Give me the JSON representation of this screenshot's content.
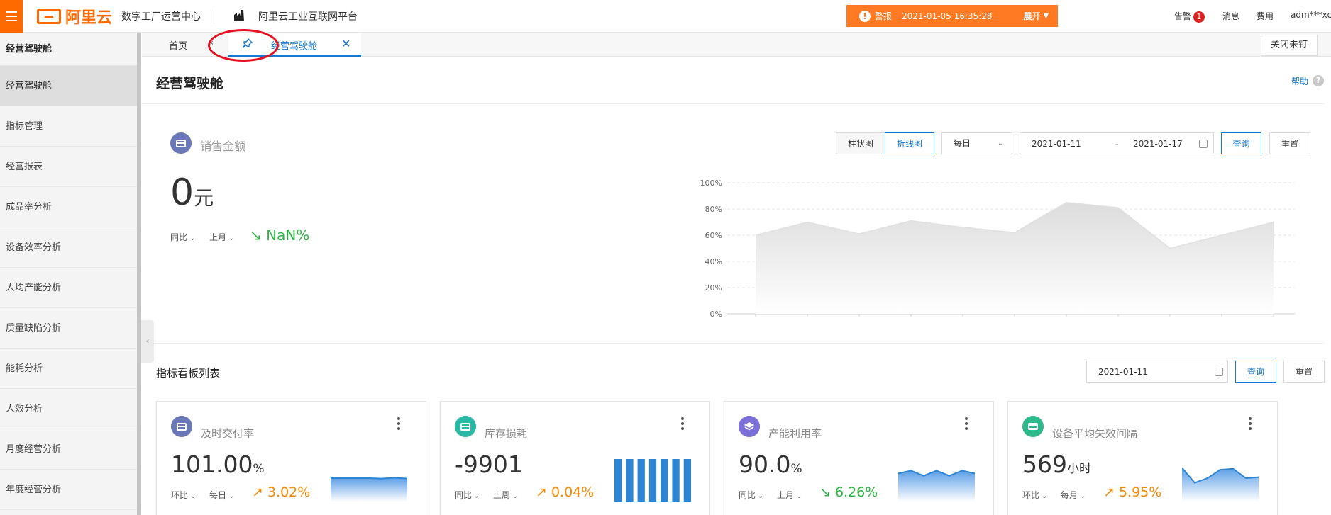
{
  "header": {
    "logo_text": "阿里云",
    "center_name": "数字工厂运营中心",
    "platform_name": "阿里云工业互联网平台",
    "alert": {
      "label": "警报",
      "time": "2021-01-05 16:35:28",
      "expand": "展开"
    },
    "nav": {
      "alarm": "告警",
      "alarm_count": "1",
      "messages": "消息",
      "billing": "费用",
      "user": "adm***xc"
    }
  },
  "sidebar": {
    "header": "经营驾驶舱",
    "items": [
      "经营驾驶舱",
      "指标管理",
      "经营报表",
      "成品率分析",
      "设备效率分析",
      "人均产能分析",
      "质量缺陷分析",
      "能耗分析",
      "人效分析",
      "月度经营分析",
      "年度经营分析"
    ]
  },
  "tabs": {
    "home": "首页",
    "active": "经营驾驶舱",
    "close_pinned": "关闭未钉"
  },
  "page": {
    "title": "经营驾驶舱",
    "help": "帮助"
  },
  "sales": {
    "title": "销售金额",
    "value": "0",
    "unit": "元",
    "compare": "同比",
    "period": "上月",
    "change": "NaN%",
    "chart_types": [
      "柱状图",
      "折线图"
    ],
    "granularity": "每日",
    "date_start": "2021-01-11",
    "date_end": "2021-01-17",
    "date_sep": "-",
    "query": "查询",
    "reset": "重置"
  },
  "chart_data": {
    "type": "area",
    "x": [
      1,
      2,
      3,
      4,
      5,
      6,
      7,
      8,
      9,
      10,
      11
    ],
    "values": [
      60,
      70,
      61,
      71,
      66,
      62,
      85,
      81,
      50,
      60,
      70
    ],
    "yticks": [
      "0%",
      "20%",
      "40%",
      "60%",
      "80%",
      "100%"
    ],
    "ylim": [
      0,
      100
    ],
    "grid": true
  },
  "indicators": {
    "title": "指标看板列表",
    "date": "2021-01-11",
    "query": "查询",
    "reset": "重置",
    "cards": [
      {
        "title": "及时交付率",
        "value": "101.00",
        "unit": "%",
        "compare": "环比",
        "period": "每日",
        "change": "3.02%",
        "direction": "up",
        "color": "#6a78b8",
        "icon": "card-icon",
        "spark": "area",
        "spark_values": [
          50,
          50,
          50,
          50,
          49,
          51,
          49
        ]
      },
      {
        "title": "库存损耗",
        "value": "-9901",
        "unit": "",
        "compare": "同比",
        "period": "上周",
        "change": "0.04%",
        "direction": "up",
        "color": "#2bb8a4",
        "icon": "inventory-icon",
        "spark": "bar",
        "spark_values": [
          100,
          100,
          100,
          100,
          100,
          100,
          100
        ]
      },
      {
        "title": "产能利用率",
        "value": "90.0",
        "unit": "%",
        "compare": "同比",
        "period": "上月",
        "change": "6.26%",
        "direction": "down",
        "color": "#7b6fd8",
        "icon": "capacity-icon",
        "spark": "area",
        "spark_values": [
          60,
          66,
          55,
          66,
          55,
          66,
          60
        ]
      },
      {
        "title": "设备平均失效间隔",
        "value": "569",
        "unit": "小时",
        "compare": "环比",
        "period": "每月",
        "change": "5.95%",
        "direction": "up",
        "color": "#2fb98a",
        "icon": "device-icon",
        "spark": "area",
        "spark_values": [
          72,
          40,
          50,
          68,
          70,
          50,
          52
        ]
      }
    ]
  }
}
